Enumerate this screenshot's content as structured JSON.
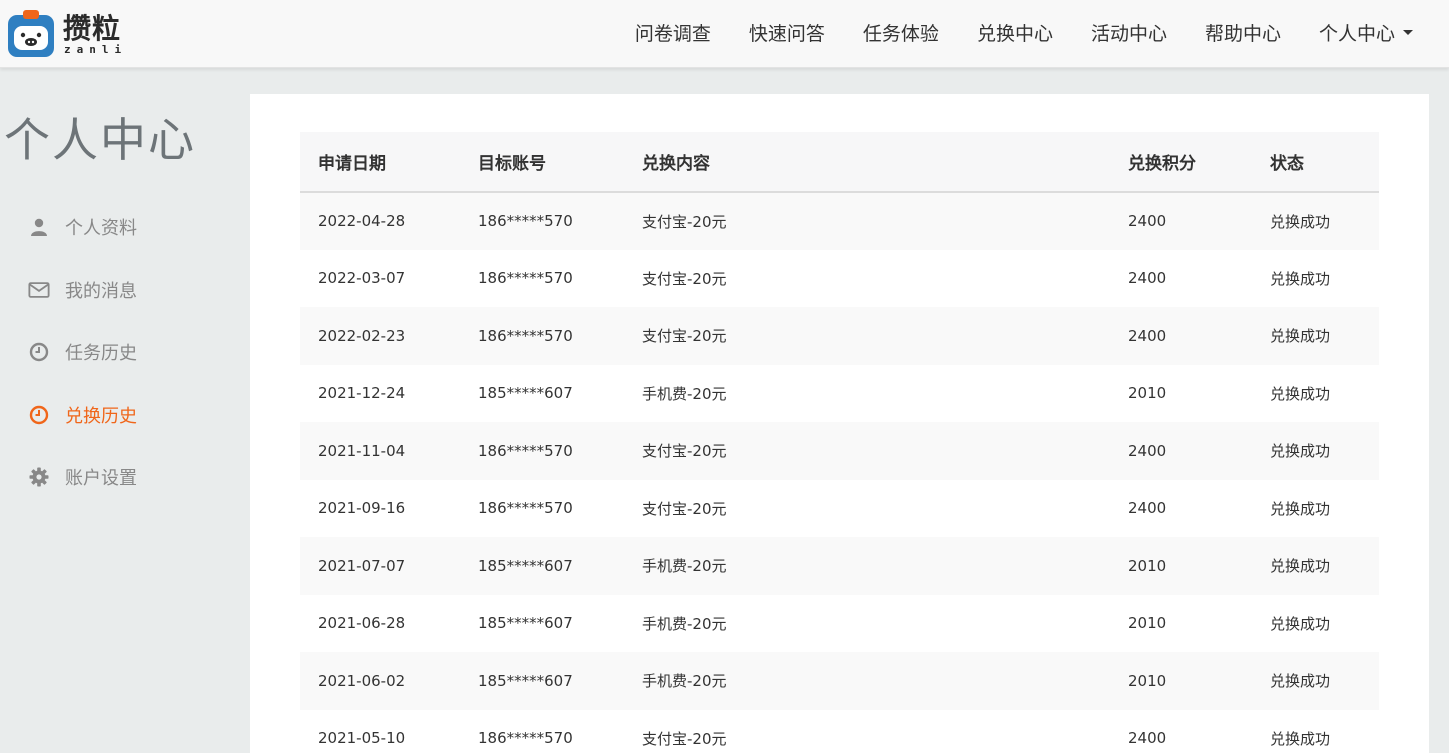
{
  "brand": {
    "name": "攒粒",
    "sub": "zanli",
    "accent": "#2f7fc1"
  },
  "nav": [
    {
      "label": "问卷调查"
    },
    {
      "label": "快速问答"
    },
    {
      "label": "任务体验"
    },
    {
      "label": "兑换中心"
    },
    {
      "label": "活动中心"
    },
    {
      "label": "帮助中心"
    },
    {
      "label": "个人中心"
    }
  ],
  "sidebar": {
    "title": "个人中心",
    "active_color": "#f0661a",
    "items": [
      {
        "label": "个人资料",
        "icon": "user-icon"
      },
      {
        "label": "我的消息",
        "icon": "envelope-icon"
      },
      {
        "label": "任务历史",
        "icon": "clock-icon"
      },
      {
        "label": "兑换历史",
        "icon": "clock-icon",
        "active": true
      },
      {
        "label": "账户设置",
        "icon": "gear-icon"
      }
    ]
  },
  "table": {
    "headers": [
      "申请日期",
      "目标账号",
      "兑换内容",
      "兑换积分",
      "状态"
    ],
    "rows": [
      [
        "2022-04-28",
        "186*****570",
        "支付宝-20元",
        "2400",
        "兑换成功"
      ],
      [
        "2022-03-07",
        "186*****570",
        "支付宝-20元",
        "2400",
        "兑换成功"
      ],
      [
        "2022-02-23",
        "186*****570",
        "支付宝-20元",
        "2400",
        "兑换成功"
      ],
      [
        "2021-12-24",
        "185*****607",
        "手机费-20元",
        "2010",
        "兑换成功"
      ],
      [
        "2021-11-04",
        "186*****570",
        "支付宝-20元",
        "2400",
        "兑换成功"
      ],
      [
        "2021-09-16",
        "186*****570",
        "支付宝-20元",
        "2400",
        "兑换成功"
      ],
      [
        "2021-07-07",
        "185*****607",
        "手机费-20元",
        "2010",
        "兑换成功"
      ],
      [
        "2021-06-28",
        "185*****607",
        "手机费-20元",
        "2010",
        "兑换成功"
      ],
      [
        "2021-06-02",
        "185*****607",
        "手机费-20元",
        "2010",
        "兑换成功"
      ],
      [
        "2021-05-10",
        "186*****570",
        "支付宝-20元",
        "2400",
        "兑换成功"
      ]
    ]
  }
}
